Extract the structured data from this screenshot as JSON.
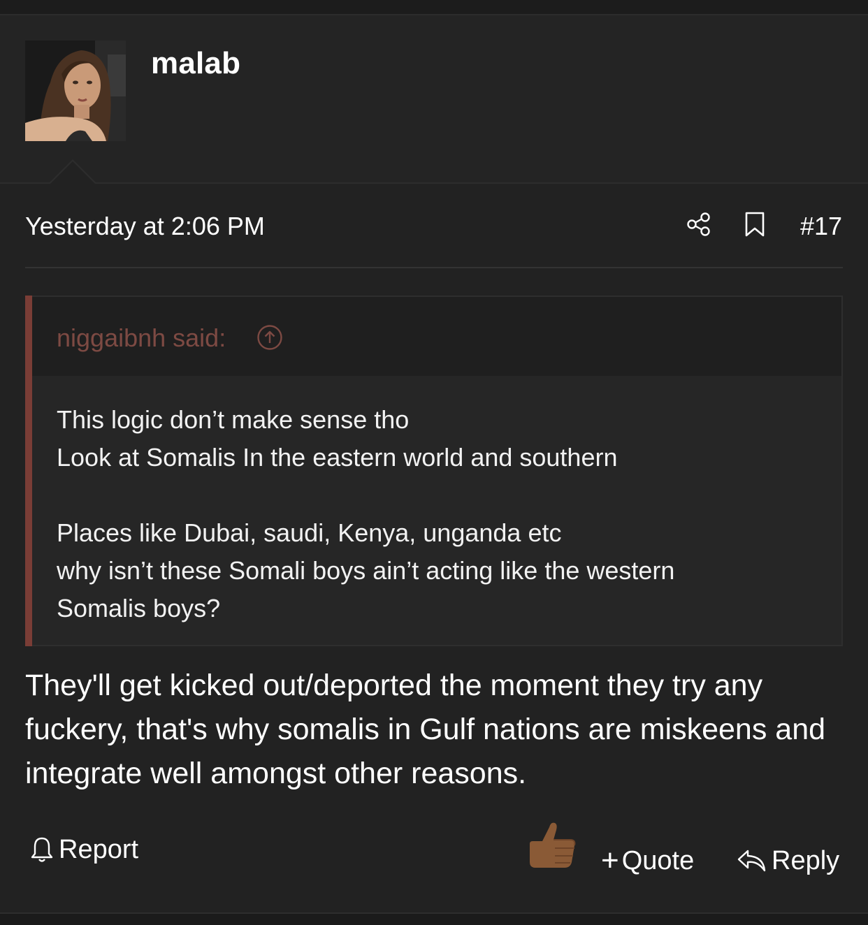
{
  "post": {
    "username": "malab",
    "timestamp": "Yesterday at 2:06 PM",
    "post_number": "#17",
    "body": "They'll get kicked out/deported the moment they try any fuckery, that's why somalis in Gulf nations are miskeens and integrate well amongst other reasons."
  },
  "quote": {
    "author_label": "niggaibnh said:",
    "lines": [
      "This logic don’t make sense tho",
      "Look at Somalis In the eastern world and southern",
      "Places like Dubai, saudi, Kenya, unganda etc",
      "why isn’t these Somali boys ain’t acting like the western Somalis boys?"
    ]
  },
  "actions": {
    "report_label": "Report",
    "quote_plus": "+",
    "quote_label": "Quote",
    "reply_label": "Reply"
  },
  "icons": {
    "share": "share-icon",
    "bookmark": "bookmark-icon",
    "quote_jump": "arrow-up-circle-icon",
    "report": "bell-icon",
    "reaction": "thumbs-up-icon",
    "reply": "reply-arrow-icon"
  },
  "colors": {
    "background": "#222222",
    "quote_accent": "#7a3d36",
    "quote_author": "#7d4a43",
    "text": "#ffffff"
  }
}
